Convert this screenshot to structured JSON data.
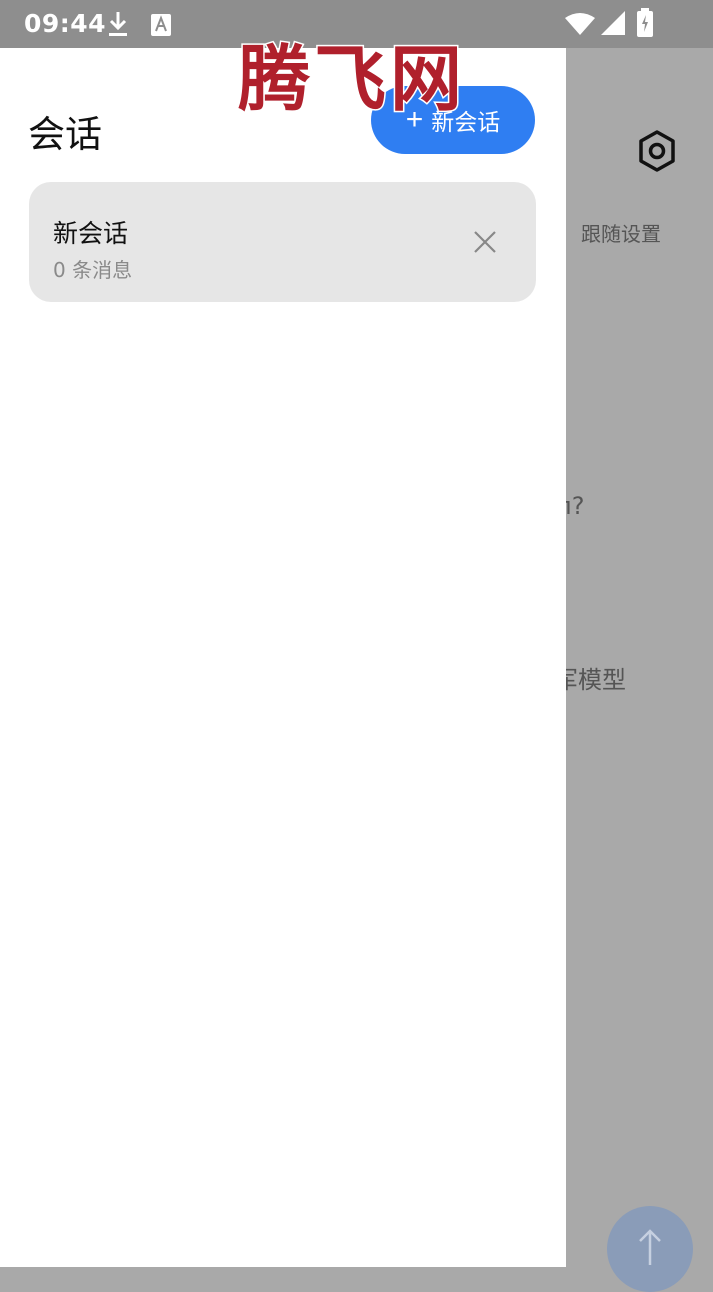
{
  "status_bar": {
    "time": "09:44"
  },
  "drawer": {
    "title": "会话",
    "new_chat_label": "新会话",
    "sessions": [
      {
        "title": "新会话",
        "subtitle": "0 条消息"
      }
    ]
  },
  "background": {
    "follow_settings": "跟随设置",
    "partial_question": "п?",
    "partial_model": "军模型"
  },
  "watermark": "腾飞网",
  "colors": {
    "accent": "#2f7ef2",
    "card_bg": "#e6e6e6",
    "scrim": "#a9a9a9",
    "watermark": "#b0202c"
  },
  "icons": {
    "download": "download-icon",
    "font": "font-a-icon",
    "wifi": "wifi-icon",
    "signal": "signal-icon",
    "battery": "battery-charging-icon",
    "settings": "settings-hex-icon",
    "close": "close-icon",
    "send": "arrow-up-icon"
  }
}
